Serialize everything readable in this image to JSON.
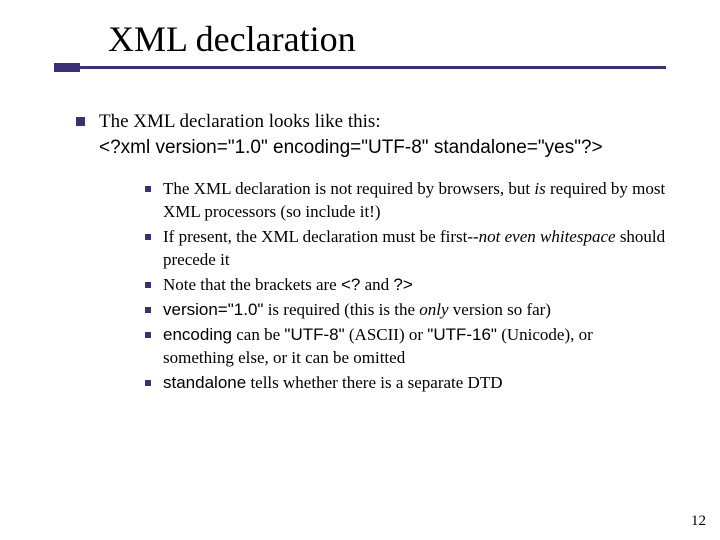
{
  "title": "XML declaration",
  "main": {
    "lead": "The XML declaration looks like this:",
    "code": "<?xml version=\"1.0\" encoding=\"UTF-8\" standalone=\"yes\"?>"
  },
  "sub": {
    "s1a": "The XML declaration is not required by browsers, but ",
    "s1b": "is",
    "s1c": " required by most XML processors (so include it!)",
    "s2a": "If present, the XML declaration must be first--",
    "s2b": "not even whitespace",
    "s2c": " should precede it",
    "s3a": "Note that the brackets are ",
    "s3b": "<?",
    "s3c": " and ",
    "s3d": "?>",
    "s4a": "version=\"1.0\"",
    "s4b": " is required (this is the ",
    "s4c": "only",
    "s4d": " version so far)",
    "s5a": "encoding",
    "s5b": " can be ",
    "s5c": "\"UTF-8\"",
    "s5d": " (ASCII) or ",
    "s5e": "\"UTF-16\"",
    "s5f": " (Unicode), or something else, or it can be omitted",
    "s6a": "standalone",
    "s6b": " tells whether there is a separate DTD"
  },
  "page": "12"
}
